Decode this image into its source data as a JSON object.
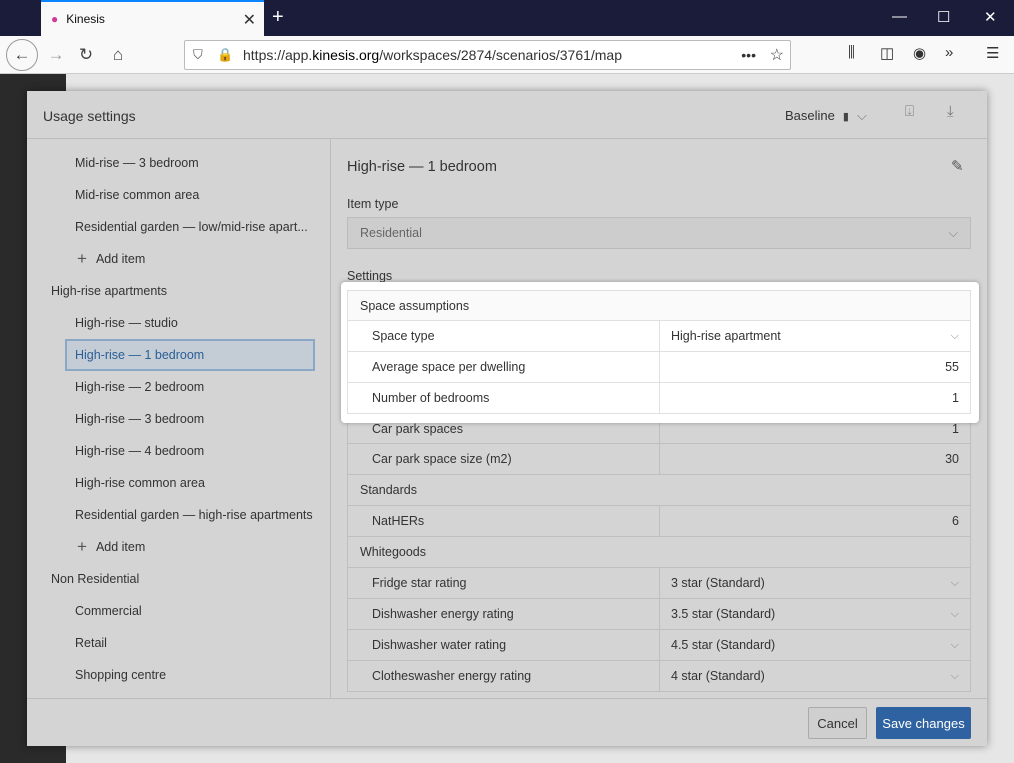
{
  "browser": {
    "tab_title": "Kinesis",
    "url_prefix": "https://app.",
    "url_domain": "kinesis.org",
    "url_path": "/workspaces/2874/scenarios/3761/map"
  },
  "modal": {
    "title": "Usage settings",
    "scenario": "Baseline",
    "sidebar": [
      {
        "kind": "sub",
        "label": "Mid-rise — 3 bedroom"
      },
      {
        "kind": "sub",
        "label": "Mid-rise common area"
      },
      {
        "kind": "sub",
        "label": "Residential garden — low/mid-rise apart..."
      },
      {
        "kind": "add",
        "label": "Add item"
      },
      {
        "kind": "grp",
        "label": "High-rise apartments"
      },
      {
        "kind": "sub",
        "label": "High-rise — studio"
      },
      {
        "kind": "sel",
        "label": "High-rise — 1 bedroom"
      },
      {
        "kind": "sub",
        "label": "High-rise — 2 bedroom"
      },
      {
        "kind": "sub",
        "label": "High-rise — 3 bedroom"
      },
      {
        "kind": "sub",
        "label": "High-rise — 4 bedroom"
      },
      {
        "kind": "sub",
        "label": "High-rise common area"
      },
      {
        "kind": "sub",
        "label": "Residential garden — high-rise apartments"
      },
      {
        "kind": "add",
        "label": "Add item"
      },
      {
        "kind": "grp",
        "label": "Non Residential"
      },
      {
        "kind": "sub",
        "label": "Commercial"
      },
      {
        "kind": "sub",
        "label": "Retail"
      },
      {
        "kind": "sub",
        "label": "Shopping centre"
      }
    ],
    "item_title": "High-rise — 1 bedroom",
    "item_type_label": "Item type",
    "item_type_value": "Residential",
    "settings_label": "Settings",
    "highlight_rows": [
      {
        "type": "head",
        "label": "Space assumptions"
      },
      {
        "type": "select",
        "label": "Space type",
        "value": "High-rise apartment"
      },
      {
        "type": "num",
        "label": "Average space per dwelling",
        "value": "55"
      },
      {
        "type": "num",
        "label": "Number of bedrooms",
        "value": "1"
      }
    ],
    "rows": [
      {
        "type": "num",
        "label": "Car park spaces",
        "value": "1"
      },
      {
        "type": "num",
        "label": "Car park space size (m2)",
        "value": "30"
      },
      {
        "type": "head",
        "label": "Standards"
      },
      {
        "type": "num",
        "label": "NatHERs",
        "value": "6"
      },
      {
        "type": "head",
        "label": "Whitegoods"
      },
      {
        "type": "select",
        "label": "Fridge star rating",
        "value": "3 star (Standard)"
      },
      {
        "type": "select",
        "label": "Dishwasher energy rating",
        "value": "3.5 star (Standard)"
      },
      {
        "type": "select",
        "label": "Dishwasher water rating",
        "value": "4.5 star (Standard)"
      },
      {
        "type": "select",
        "label": "Clotheswasher energy rating",
        "value": "4 star (Standard)"
      }
    ],
    "cancel_label": "Cancel",
    "save_label": "Save changes"
  }
}
